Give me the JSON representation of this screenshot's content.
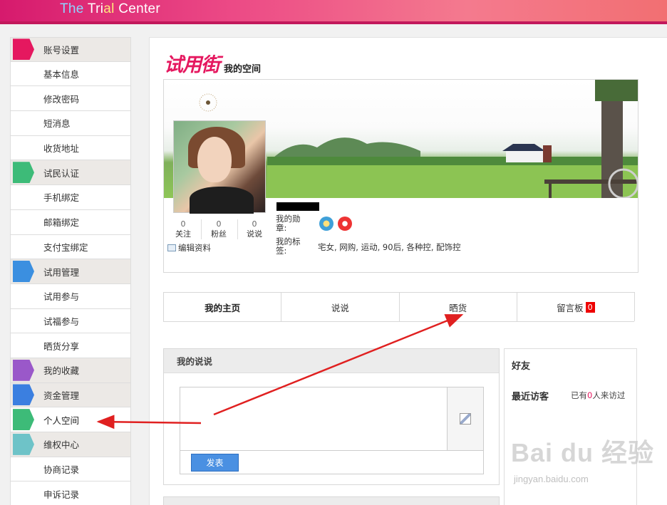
{
  "header": {
    "brand_part1": "The",
    "brand_part2": " Tri",
    "brand_part3": "al",
    "brand_part4": " Center"
  },
  "sidebar": {
    "items": [
      {
        "label": "账号设置",
        "section": true,
        "icon": "user-icon",
        "color": "#e5185f"
      },
      {
        "label": "基本信息"
      },
      {
        "label": "修改密码"
      },
      {
        "label": "短消息"
      },
      {
        "label": "收货地址"
      },
      {
        "label": "试民认证",
        "section": true,
        "icon": "list-icon",
        "color": "#3dbb78"
      },
      {
        "label": "手机绑定"
      },
      {
        "label": "邮箱绑定"
      },
      {
        "label": "支付宝绑定"
      },
      {
        "label": "试用管理",
        "section": true,
        "icon": "person-icon",
        "color": "#3b8fe0"
      },
      {
        "label": "试用参与"
      },
      {
        "label": "试福参与"
      },
      {
        "label": "晒货分享"
      },
      {
        "label": "我的收藏",
        "section": true,
        "icon": "star-icon",
        "color": "#9a58c9"
      },
      {
        "label": "资金管理",
        "section": true,
        "icon": "money-icon",
        "color": "#3b7fe0"
      },
      {
        "label": "个人空间",
        "section": false,
        "active": true,
        "icon": "space-icon",
        "color": "#3dbb78"
      },
      {
        "label": "维权中心",
        "section": true,
        "icon": "shield-icon",
        "color": "#6ec3c8"
      },
      {
        "label": "协商记录"
      },
      {
        "label": "申诉记录"
      }
    ]
  },
  "main": {
    "logo": "试用街",
    "space_title": "我的空间",
    "profile": {
      "stats": [
        {
          "num": "0",
          "label": "关注"
        },
        {
          "num": "0",
          "label": "粉丝"
        },
        {
          "num": "0",
          "label": "说说"
        }
      ],
      "edit_label": "编辑资料",
      "medal_label": "我的勋章:",
      "tag_label": "我的标签:",
      "tags": "宅女, 网购, 运动, 90后, 各种控, 配饰控"
    },
    "tabs": [
      {
        "label": "我的主页",
        "active": true
      },
      {
        "label": "说说"
      },
      {
        "label": "晒货"
      },
      {
        "label": "留言板",
        "badge": "0"
      }
    ],
    "say": {
      "title": "我的说说",
      "submit": "发表"
    },
    "friends": {
      "title": "好友",
      "visitors_title": "最近访客",
      "visitors_prefix": "已有",
      "visitors_count": "0",
      "visitors_suffix": "人来访过"
    }
  },
  "watermark": {
    "big": "Bai du 经验",
    "small": "jingyan.baidu.com"
  },
  "colors": {
    "accent": "#e5185f",
    "arrow": "#e02020",
    "button": "#4a90e2"
  }
}
